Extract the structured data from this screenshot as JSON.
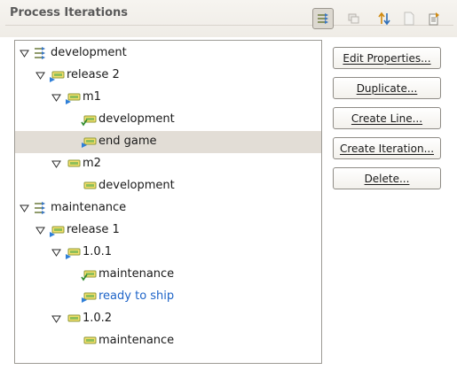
{
  "header": {
    "title": "Process Iterations",
    "toolbar": [
      {
        "icon": "link-with-editor-icon",
        "pressed": true
      },
      {
        "icon": "collapse-all-icon",
        "pressed": false
      },
      {
        "icon": "sort-icon",
        "pressed": false
      },
      {
        "icon": "blank-page-icon",
        "pressed": false
      },
      {
        "icon": "export-icon",
        "pressed": false
      }
    ]
  },
  "tree": {
    "nodes": [
      {
        "label": "development",
        "depth": 0,
        "expanded": true,
        "type": "line",
        "selected": false,
        "link": false
      },
      {
        "label": "release 2",
        "depth": 1,
        "expanded": true,
        "type": "release",
        "selected": false,
        "link": false
      },
      {
        "label": "m1",
        "depth": 2,
        "expanded": true,
        "type": "release",
        "selected": false,
        "link": false
      },
      {
        "label": "development",
        "depth": 3,
        "expanded": null,
        "type": "iteration-done",
        "selected": false,
        "link": false
      },
      {
        "label": "end game",
        "depth": 3,
        "expanded": null,
        "type": "iteration-current",
        "selected": true,
        "link": false
      },
      {
        "label": "m2",
        "depth": 2,
        "expanded": true,
        "type": "iteration",
        "selected": false,
        "link": false
      },
      {
        "label": "development",
        "depth": 3,
        "expanded": null,
        "type": "iteration",
        "selected": false,
        "link": false
      },
      {
        "label": "maintenance",
        "depth": 0,
        "expanded": true,
        "type": "line",
        "selected": false,
        "link": false
      },
      {
        "label": "release 1",
        "depth": 1,
        "expanded": true,
        "type": "release",
        "selected": false,
        "link": false
      },
      {
        "label": "1.0.1",
        "depth": 2,
        "expanded": true,
        "type": "release",
        "selected": false,
        "link": false
      },
      {
        "label": "maintenance",
        "depth": 3,
        "expanded": null,
        "type": "iteration-done",
        "selected": false,
        "link": false
      },
      {
        "label": "ready to ship",
        "depth": 3,
        "expanded": null,
        "type": "iteration-current",
        "selected": false,
        "link": true
      },
      {
        "label": "1.0.2",
        "depth": 2,
        "expanded": true,
        "type": "iteration",
        "selected": false,
        "link": false
      },
      {
        "label": "maintenance",
        "depth": 3,
        "expanded": null,
        "type": "iteration",
        "selected": false,
        "link": false
      }
    ]
  },
  "buttons": {
    "edit_properties": "Edit Properties...",
    "duplicate": "Duplicate...",
    "create_line": "Create Line...",
    "create_iteration": "Create Iteration...",
    "delete": "Delete..."
  },
  "colors": {
    "selection": "#e2ddd6",
    "link": "#1e64c8",
    "title": "#5a5a5a"
  }
}
